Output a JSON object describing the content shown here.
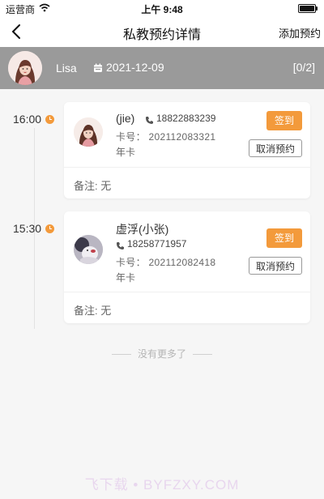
{
  "status_bar": {
    "carrier": "运营商",
    "time": "上午 9:48"
  },
  "nav": {
    "title": "私教预约详情",
    "add_label": "添加预约",
    "back_icon": "chevron-left-icon"
  },
  "coach": {
    "name": "Lisa",
    "date": "2021-12-09",
    "count": "[0/2]"
  },
  "bookings": [
    {
      "time": "16:00",
      "member_name": "(jie)",
      "phone": "18822883239",
      "card_no": "卡号：  202112083321",
      "card_type": "年卡",
      "checkin_label": "签到",
      "cancel_label": "取消预约",
      "remark": "备注: 无"
    },
    {
      "time": "15:30",
      "member_name": "虚浮(小张)",
      "phone": "18258771957",
      "card_no": "卡号：  202112082418",
      "card_type": "年卡",
      "checkin_label": "签到",
      "cancel_label": "取消预约",
      "remark": "备注: 无"
    }
  ],
  "footer": {
    "no_more": "没有更多了"
  },
  "watermark": "飞下载 • BYFZXY.COM",
  "colors": {
    "accent": "#f39a3b",
    "coach_bar": "#9a9a9a",
    "background": "#f6f6f6"
  }
}
